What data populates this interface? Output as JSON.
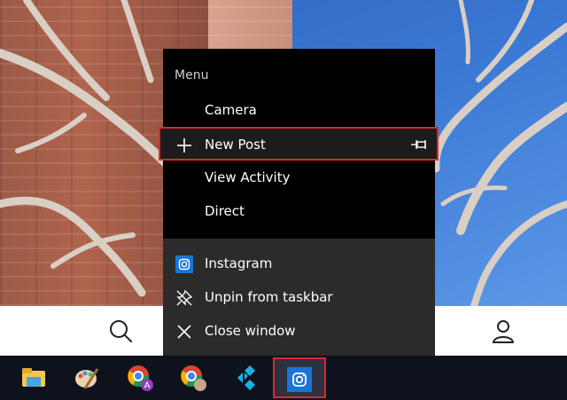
{
  "jumplist": {
    "header": "Menu",
    "tasks": [
      {
        "label": "Camera"
      },
      {
        "label": "New Post"
      },
      {
        "label": "View Activity"
      },
      {
        "label": "Direct"
      }
    ],
    "actions": [
      {
        "label": "Instagram",
        "icon": "instagram-icon"
      },
      {
        "label": "Unpin from taskbar",
        "icon": "unpin-icon"
      },
      {
        "label": "Close window",
        "icon": "close-icon"
      }
    ]
  },
  "taskbar": {
    "icons": [
      "file-explorer-icon",
      "paint-icon",
      "chrome-profile-a-icon",
      "chrome-profile-icon",
      "kodi-icon",
      "instagram-app-icon"
    ],
    "active_icon": "instagram-app-icon"
  },
  "colors": {
    "highlight_border": "#e0262f",
    "instagram_blue": "#1b74d6",
    "jumplist_bg": "#000000",
    "jumplist_lower_bg": "#2b2b2b"
  }
}
